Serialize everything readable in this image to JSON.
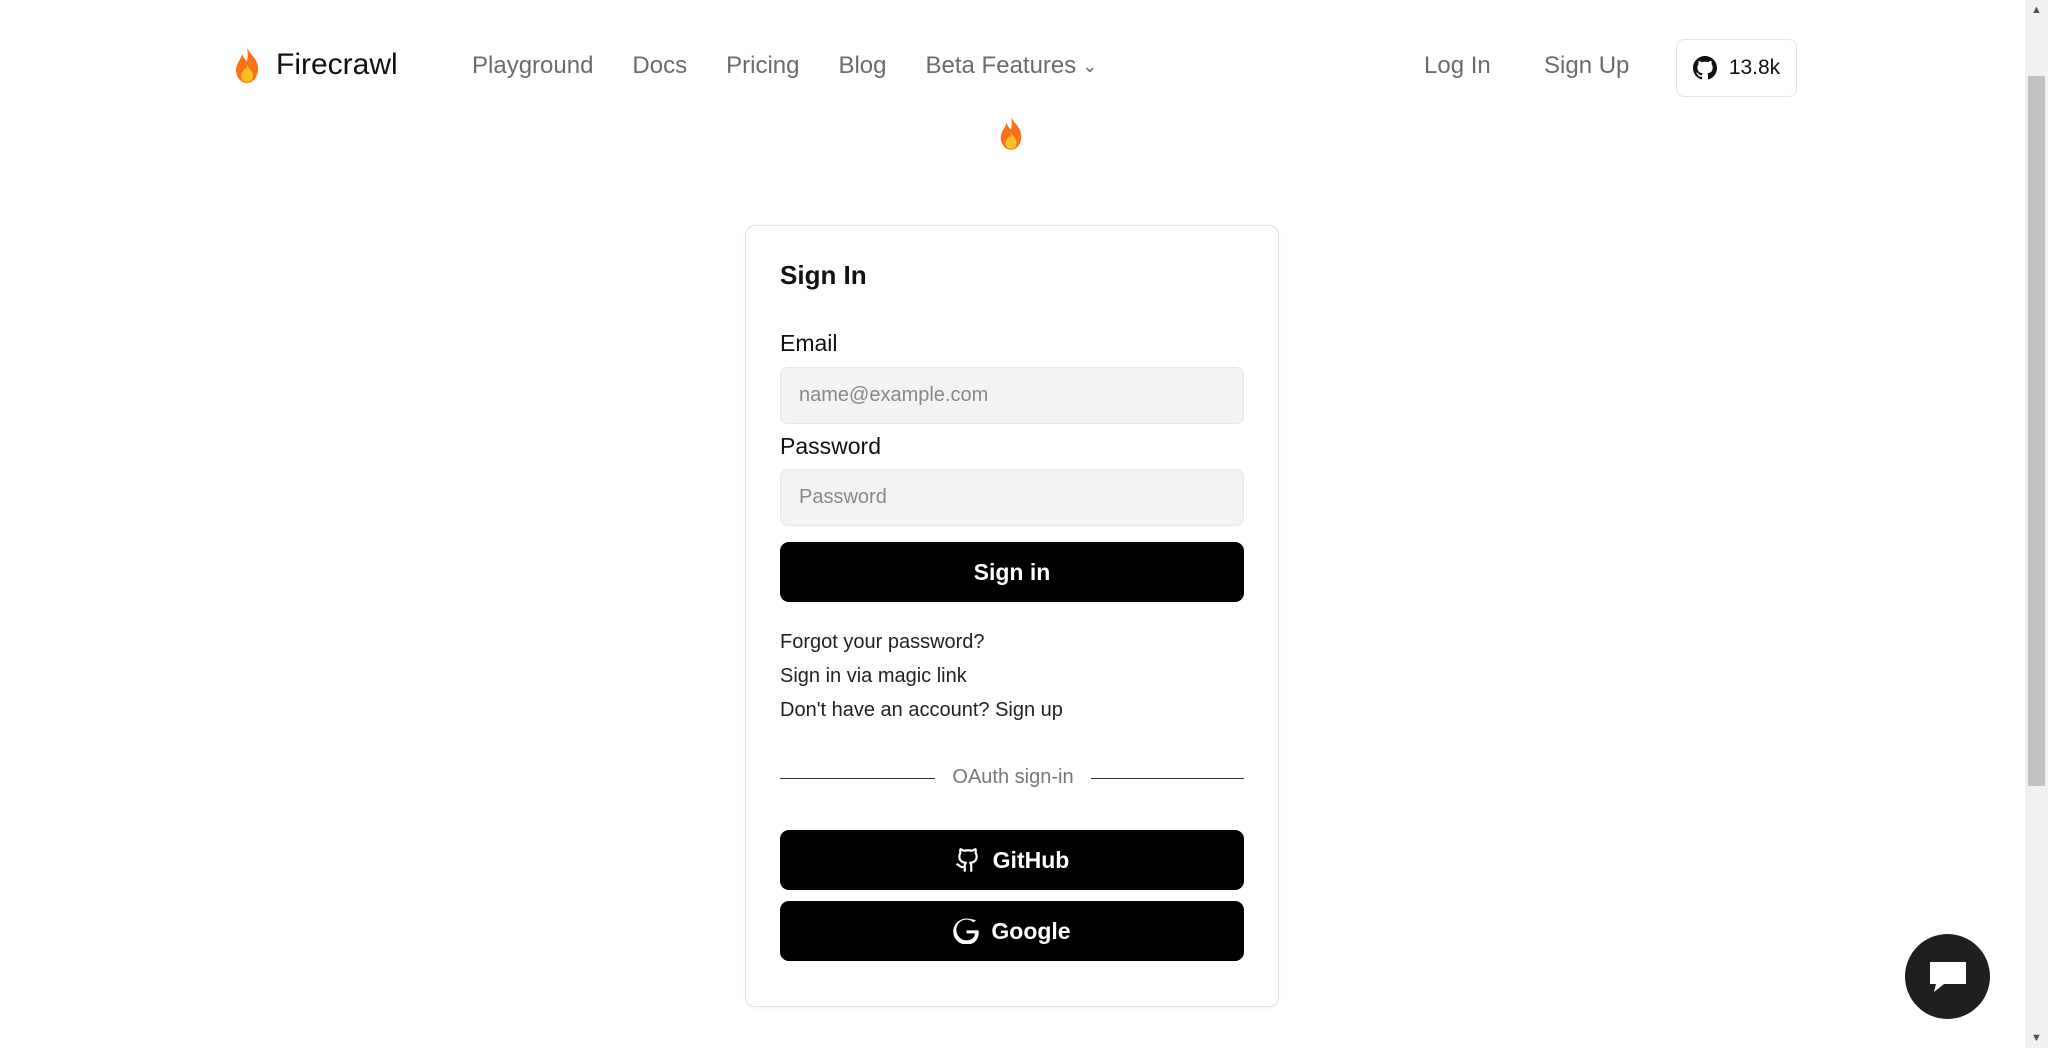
{
  "header": {
    "brand": "Firecrawl",
    "nav": [
      {
        "label": "Playground"
      },
      {
        "label": "Docs"
      },
      {
        "label": "Pricing"
      },
      {
        "label": "Blog"
      },
      {
        "label": "Beta Features"
      }
    ],
    "login_label": "Log In",
    "signup_label": "Sign Up",
    "github_stars": "13.8k"
  },
  "card": {
    "title": "Sign In",
    "email_label": "Email",
    "email_placeholder": "name@example.com",
    "password_label": "Password",
    "password_placeholder": "Password",
    "signin_button": "Sign in",
    "forgot_link": "Forgot your password?",
    "magic_link": "Sign in via magic link",
    "signup_link": "Don't have an account? Sign up",
    "oauth_divider": "OAuth sign-in",
    "github_button": "GitHub",
    "google_button": "Google"
  },
  "colors": {
    "accent": "#f97316",
    "primary_button": "#000000",
    "muted_text": "#6b6b6b"
  },
  "icons": [
    "flame-icon",
    "chevron-down-icon",
    "github-icon",
    "google-icon",
    "chat-icon"
  ]
}
